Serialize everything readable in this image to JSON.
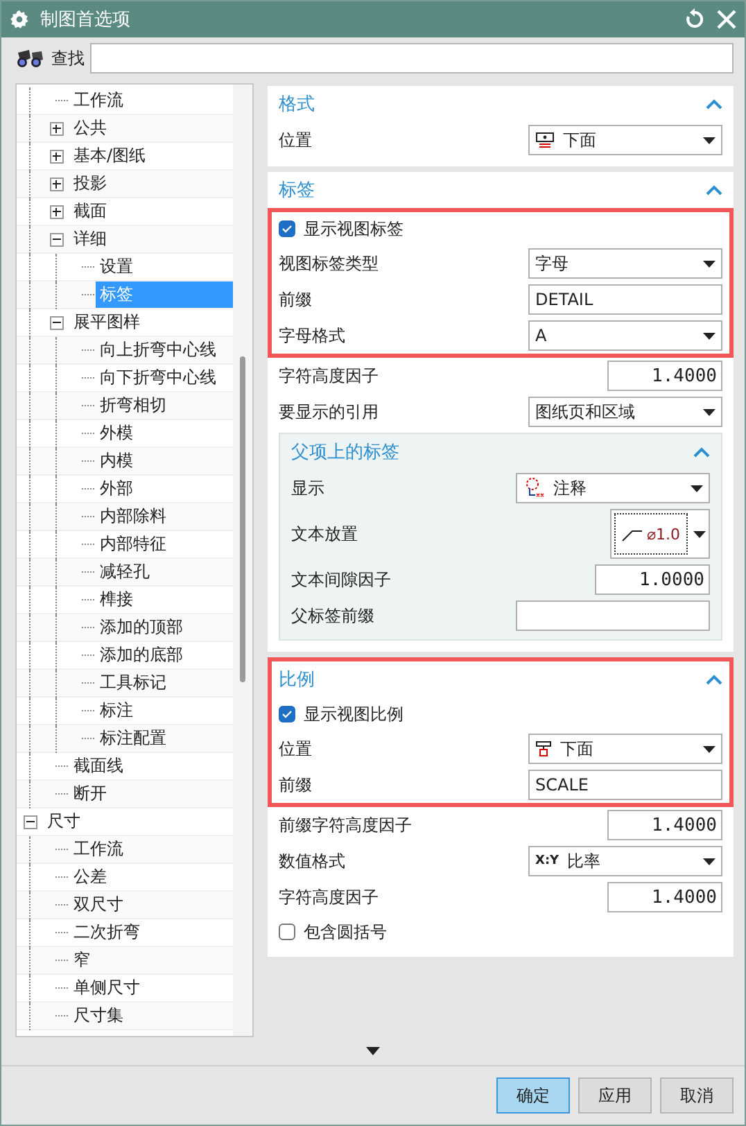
{
  "window": {
    "title": "制图首选项"
  },
  "search": {
    "label": "查找"
  },
  "tree": {
    "continued_items": [
      {
        "label": "工作流",
        "selected": false
      },
      {
        "label": "公共",
        "selected": false,
        "expanded": false
      },
      {
        "label": "基本/图纸",
        "selected": false,
        "expanded": false
      },
      {
        "label": "投影",
        "selected": false,
        "expanded": false
      },
      {
        "label": "截面",
        "selected": false,
        "expanded": false
      },
      {
        "label": "详细",
        "selected": false,
        "expanded": true,
        "children": [
          {
            "label": "设置",
            "selected": false
          },
          {
            "label": "标签",
            "selected": true
          }
        ]
      },
      {
        "label": "展平图样",
        "selected": false,
        "expanded": true,
        "children": [
          {
            "label": "向上折弯中心线",
            "selected": false
          },
          {
            "label": "向下折弯中心线",
            "selected": false
          },
          {
            "label": "折弯相切",
            "selected": false
          },
          {
            "label": "外模",
            "selected": false
          },
          {
            "label": "内模",
            "selected": false
          },
          {
            "label": "外部",
            "selected": false
          },
          {
            "label": "内部除料",
            "selected": false
          },
          {
            "label": "内部特征",
            "selected": false
          },
          {
            "label": "减轻孔",
            "selected": false
          },
          {
            "label": "榫接",
            "selected": false
          },
          {
            "label": "添加的顶部",
            "selected": false
          },
          {
            "label": "添加的底部",
            "selected": false
          },
          {
            "label": "工具标记",
            "selected": false
          },
          {
            "label": "标注",
            "selected": false
          },
          {
            "label": "标注配置",
            "selected": false
          }
        ]
      },
      {
        "label": "截面线",
        "selected": false
      },
      {
        "label": "断开",
        "selected": false
      }
    ],
    "items": [
      {
        "label": "尺寸",
        "selected": false,
        "expanded": true,
        "children": [
          {
            "label": "工作流",
            "selected": false
          },
          {
            "label": "公差",
            "selected": false
          },
          {
            "label": "双尺寸",
            "selected": false
          },
          {
            "label": "二次折弯",
            "selected": false
          },
          {
            "label": "窄",
            "selected": false
          },
          {
            "label": "单侧尺寸",
            "selected": false
          },
          {
            "label": "尺寸集",
            "selected": false
          }
        ]
      }
    ]
  },
  "sections": [
    {
      "title": "格式",
      "expanded": true,
      "groups": [
        {
          "highlighted": false,
          "rows": [
            {
              "kind": "icon-dropdown",
              "label": "位置",
              "value": "下面"
            }
          ]
        }
      ]
    },
    {
      "title": "标签",
      "expanded": true,
      "groups": [
        {
          "highlighted": true,
          "rows": [
            {
              "kind": "checkbox",
              "label": "显示视图标签",
              "checked": true
            },
            {
              "kind": "dropdown",
              "label": "视图标签类型",
              "value": "字母"
            },
            {
              "kind": "text",
              "label": "前缀",
              "value": "DETAIL"
            },
            {
              "kind": "dropdown",
              "label": "字母格式",
              "value": "A"
            }
          ]
        },
        {
          "highlighted": false,
          "rows": [
            {
              "kind": "number",
              "label": "字符高度因子",
              "value": "1.4000"
            },
            {
              "kind": "dropdown",
              "label": "要显示的引用",
              "value": "图纸页和区域"
            },
            {
              "kind": "subsection",
              "title": "父项上的标签",
              "expanded": true,
              "rows": [
                {
                  "kind": "icon-dropdown",
                  "label": "显示",
                  "value": "注释"
                },
                {
                  "kind": "image-dropdown",
                  "label": "文本放置",
                  "value": "⌀1.0"
                },
                {
                  "kind": "number",
                  "label": "文本间隙因子",
                  "value": "1.0000"
                },
                {
                  "kind": "text",
                  "label": "父标签前缀"
                }
              ]
            }
          ]
        }
      ]
    },
    {
      "title": "比例",
      "expanded": true,
      "title_in_highlight": true,
      "groups": [
        {
          "highlighted": true,
          "rows": [
            {
              "kind": "checkbox",
              "label": "显示视图比例",
              "checked": true
            },
            {
              "kind": "icon-dropdown",
              "label": "位置",
              "value": "下面"
            },
            {
              "kind": "text",
              "label": "前缀",
              "value": "SCALE"
            }
          ]
        },
        {
          "highlighted": false,
          "rows": [
            {
              "kind": "number",
              "label": "前缀字符高度因子",
              "value": "1.4000"
            },
            {
              "kind": "dropdown",
              "label": "数值格式",
              "icon_text": "X:Y",
              "value": "比率"
            },
            {
              "kind": "number",
              "label": "字符高度因子",
              "value": "1.4000"
            },
            {
              "kind": "checkbox",
              "label": "包含圆括号",
              "checked": false
            }
          ]
        }
      ]
    }
  ],
  "buttons": [
    {
      "label": "确定",
      "default": true
    },
    {
      "label": "应用",
      "default": false
    },
    {
      "label": "取消",
      "default": false
    }
  ]
}
